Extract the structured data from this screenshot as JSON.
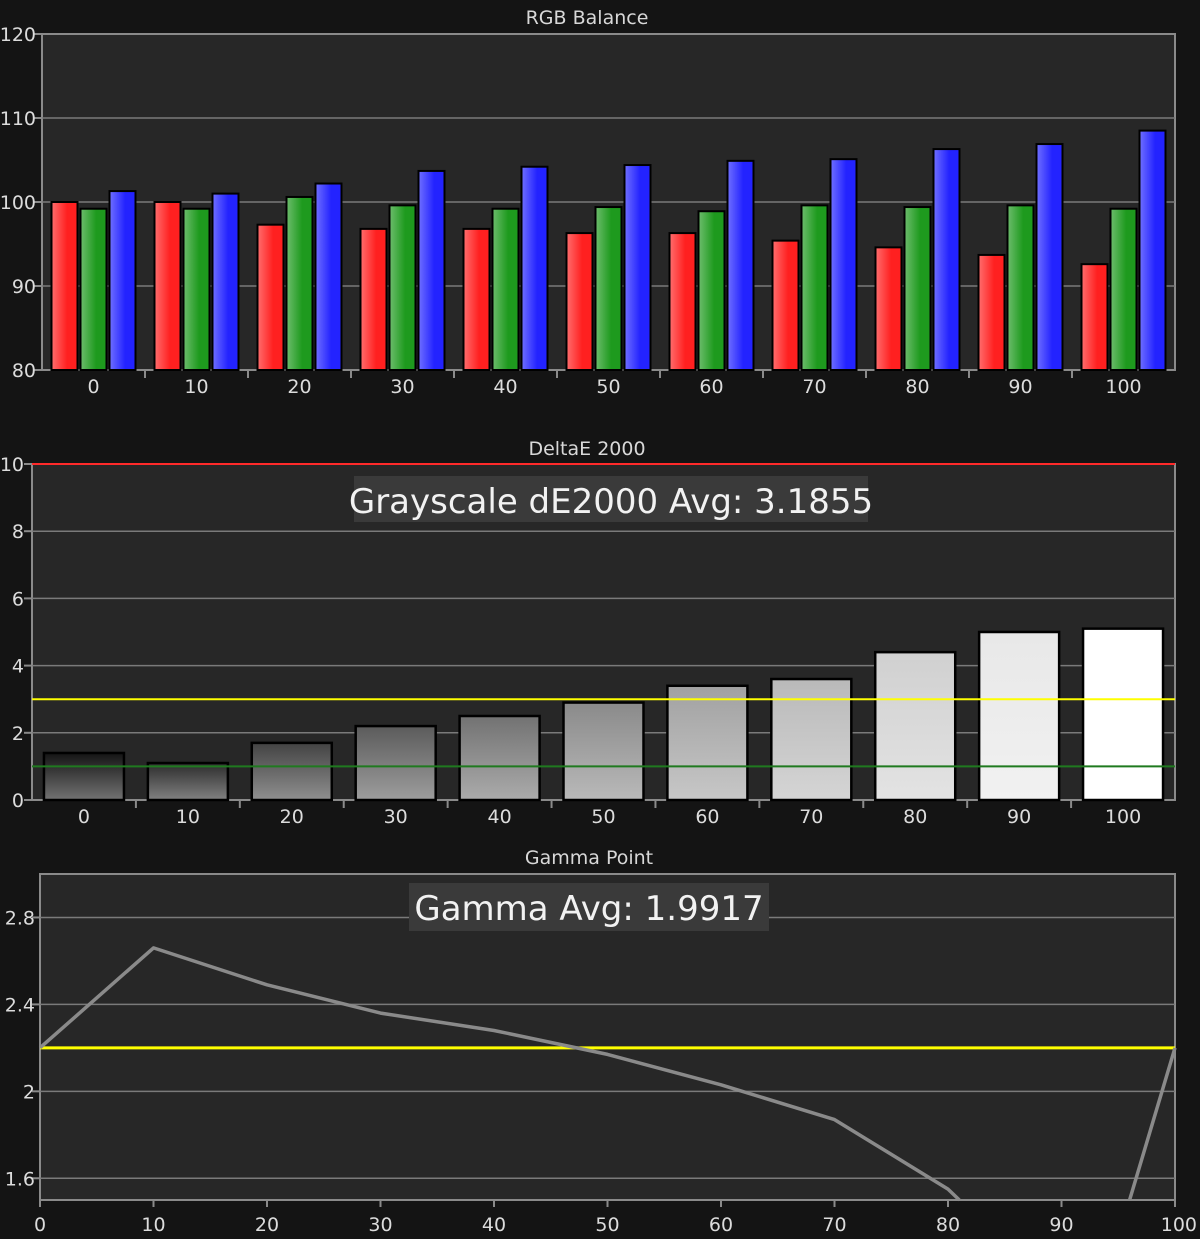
{
  "colors": {
    "page_bg": "#141414",
    "plot_bg": "#272727",
    "frame": "#8a8a8a",
    "grid": "#7a7a7a",
    "red": "#ff2020",
    "green": "#1e9a1e",
    "blue": "#2323ff",
    "yellow": "#ffff00",
    "dark_green": "#1f7a1f",
    "limit_red": "#ff2a2a",
    "gamma_line": "#8a8a8a",
    "label_box": "#3a3a3a"
  },
  "chart_data": [
    {
      "type": "bar",
      "title": "RGB Balance",
      "categories": [
        "0",
        "10",
        "20",
        "30",
        "40",
        "50",
        "60",
        "70",
        "80",
        "90",
        "100"
      ],
      "y_ticks": [
        "80",
        "90",
        "100",
        "110",
        "120"
      ],
      "ylim": [
        80,
        120
      ],
      "grid": true,
      "series": [
        {
          "color_key": "red",
          "values": [
            100.0,
            100.0,
            97.3,
            96.8,
            96.8,
            96.3,
            96.3,
            95.4,
            94.6,
            93.7,
            92.6
          ]
        },
        {
          "color_key": "green",
          "values": [
            99.2,
            99.2,
            100.6,
            99.6,
            99.2,
            99.4,
            98.9,
            99.6,
            99.4,
            99.6,
            99.2
          ]
        },
        {
          "color_key": "blue",
          "values": [
            101.3,
            101.0,
            102.2,
            103.7,
            104.2,
            104.4,
            104.9,
            105.1,
            106.3,
            106.9,
            108.5
          ]
        }
      ]
    },
    {
      "type": "bar",
      "title": "DeltaE 2000",
      "annotation": "Grayscale dE2000 Avg: 3.1855",
      "categories": [
        "0",
        "10",
        "20",
        "30",
        "40",
        "50",
        "60",
        "70",
        "80",
        "90",
        "100"
      ],
      "y_ticks": [
        "0",
        "2",
        "4",
        "6",
        "8",
        "10"
      ],
      "ylim": [
        0,
        10
      ],
      "grid": true,
      "values": [
        1.4,
        1.1,
        1.7,
        2.2,
        2.5,
        2.9,
        3.4,
        3.6,
        4.4,
        5.0,
        5.1
      ],
      "reference_lines": [
        {
          "value": 10,
          "color_key": "limit_red"
        },
        {
          "value": 3,
          "color_key": "yellow"
        },
        {
          "value": 1,
          "color_key": "dark_green"
        }
      ]
    },
    {
      "type": "line",
      "title": "Gamma Point",
      "annotation": "Gamma Avg: 1.9917",
      "x_ticks": [
        "0",
        "10",
        "20",
        "30",
        "40",
        "50",
        "60",
        "70",
        "80",
        "90",
        "100"
      ],
      "y_ticks": [
        "1.6",
        "2",
        "2.4",
        "2.8"
      ],
      "xlim": [
        0,
        100
      ],
      "ylim": [
        1.5,
        3.0
      ],
      "grid": true,
      "x": [
        0,
        10,
        20,
        30,
        40,
        50,
        60,
        70,
        80,
        81,
        96,
        100
      ],
      "y": [
        2.2,
        2.66,
        2.49,
        2.36,
        2.28,
        2.17,
        2.03,
        1.87,
        1.55,
        1.5,
        1.5,
        2.2
      ],
      "reference_lines": [
        {
          "value": 2.2,
          "color_key": "yellow"
        }
      ]
    }
  ]
}
